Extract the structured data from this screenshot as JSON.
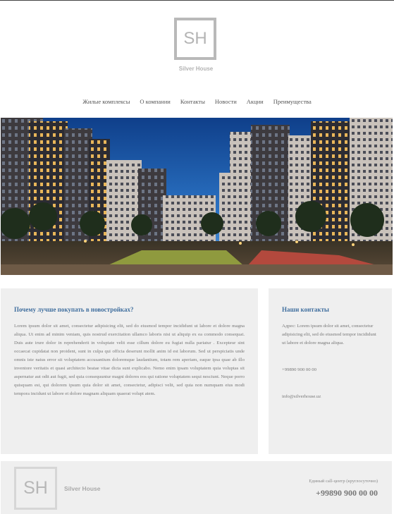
{
  "brand": {
    "logo_letters": "SH",
    "name": "Silver House"
  },
  "nav": {
    "items": [
      "Жилые комплексы",
      "О компании",
      "Контакты",
      "Новости",
      "Акции",
      "Преимущества"
    ]
  },
  "main": {
    "heading": "Почему лучше покупать в новостройках?",
    "text": "Lorem ipsum dolor sit amet, consectetur adipisicing elit, sed do eiusmod tempor incididunt ut labore et dolore magna aliqua. Ut enim ad minim veniam, quis nostrud exercitation ullamco laboris nisi ut aliquip ex ea commodo consequat. Duis aute irure dolor in reprehenderit in voluptate velit esse cillum dolore eu fugiat nulla pariatur . Excepteur sint occaecat cupidatat non proident, sunt in culpa qui officia deserunt mollit anim id est laborum. Sed ut perspiciatis unde omnis iste natus error sit voluptatem accusantium doloremque laudantium, totam rem aperiam, eaque ipsa quae ab illo inventore veritatis et quasi architecto beatae vitae dicta sunt explicabo. Nemo enim ipsam voluptatem quia voluptas sit aspernatur aut odit aut fugit, sed quia consequuntur magni dolores eos qui ratione voluptatem sequi nesciunt. Neque porro quisquam est, qui dolorem ipsum quia dolor sit amet, consectetur, adipisci velit, sed quia non numquam eius modi tempora incidunt ut labore et dolore magnam aliquam quaerat volupt atem."
  },
  "contacts": {
    "heading": "Наши контакты",
    "address": "Адрес: Lorem ipsum dolor sit amet, consectetur adipisicing elit, sed do eiusmod tempor incididunt ut labore et dolore magna aliqua.",
    "phone": "+99890 900 00 00",
    "email": "info@silverhouse.uz"
  },
  "footer": {
    "logo_letters": "SH",
    "name": "Silver House",
    "caption": "Единый call-центр (круглосуточно)",
    "phone": "+99890 900 00 00"
  },
  "colors": {
    "heading_blue": "#3f6e9e",
    "panel_bg": "#efefef",
    "logo_grey": "#b9b9b9"
  }
}
